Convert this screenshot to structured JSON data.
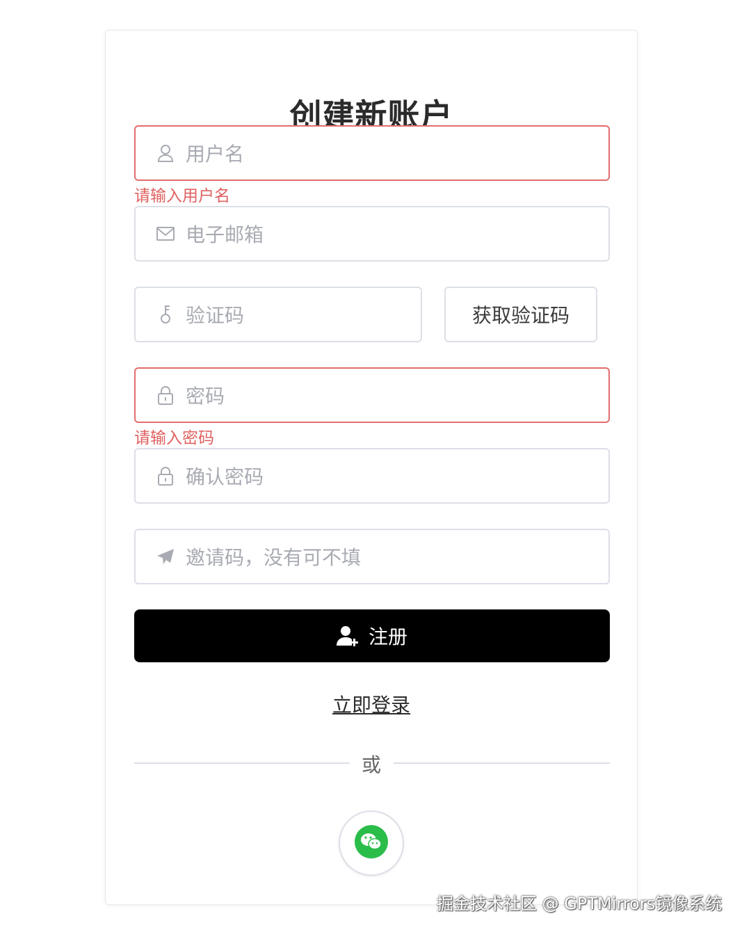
{
  "title": "创建新账户",
  "form": {
    "username": {
      "placeholder": "用户名",
      "error": "请输入用户名"
    },
    "email": {
      "placeholder": "电子邮箱"
    },
    "code": {
      "placeholder": "验证码",
      "button_label": "获取验证码"
    },
    "password": {
      "placeholder": "密码",
      "error": "请输入密码"
    },
    "confirm": {
      "placeholder": "确认密码"
    },
    "invite": {
      "placeholder": "邀请码，没有可不填"
    },
    "submit_label": "注册"
  },
  "login_link": "立即登录",
  "divider_text": "或",
  "social": {
    "icon": "wechat-icon",
    "color": "#2bbd4a"
  },
  "watermark": "掘金技术社区 @ GPTMirrors镜像系统",
  "colors": {
    "error": "#e06060",
    "primary": "#000000"
  }
}
